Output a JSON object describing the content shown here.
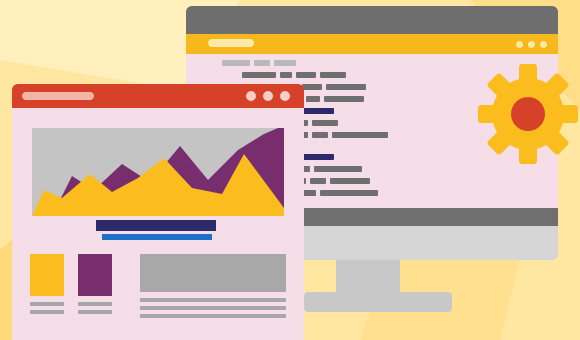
{
  "illustration": {
    "subject": "",
    "colors": {
      "background": "#ffe6a1",
      "background_light": "#fff2c4",
      "monitor_topbar": "#6e6e6e",
      "monitor_urlbar": "#f7b81b",
      "screen": "#f6dee9",
      "code_gray": "#6f6f6f",
      "code_navy": "#2c2a6b",
      "bezel_dark": "#6f6f6f",
      "bezel": "#d6d6d6",
      "stand": "#c8c8c8",
      "gear": "#fbbd1d",
      "gear_center": "#d6412a",
      "window_titlebar": "#d6412a",
      "window_body": "#f6dee9",
      "chart_bg": "#c4c4c4",
      "chart_yellow": "#fbbd1d",
      "chart_purple": "#772d6e",
      "bar_navy": "#2c2a6b",
      "bar_blue": "#1f6fc4",
      "placeholder_gray": "#a8a8a8"
    },
    "icons": {
      "gear": "gear-icon",
      "window_controls": "window-dots-icon"
    }
  }
}
